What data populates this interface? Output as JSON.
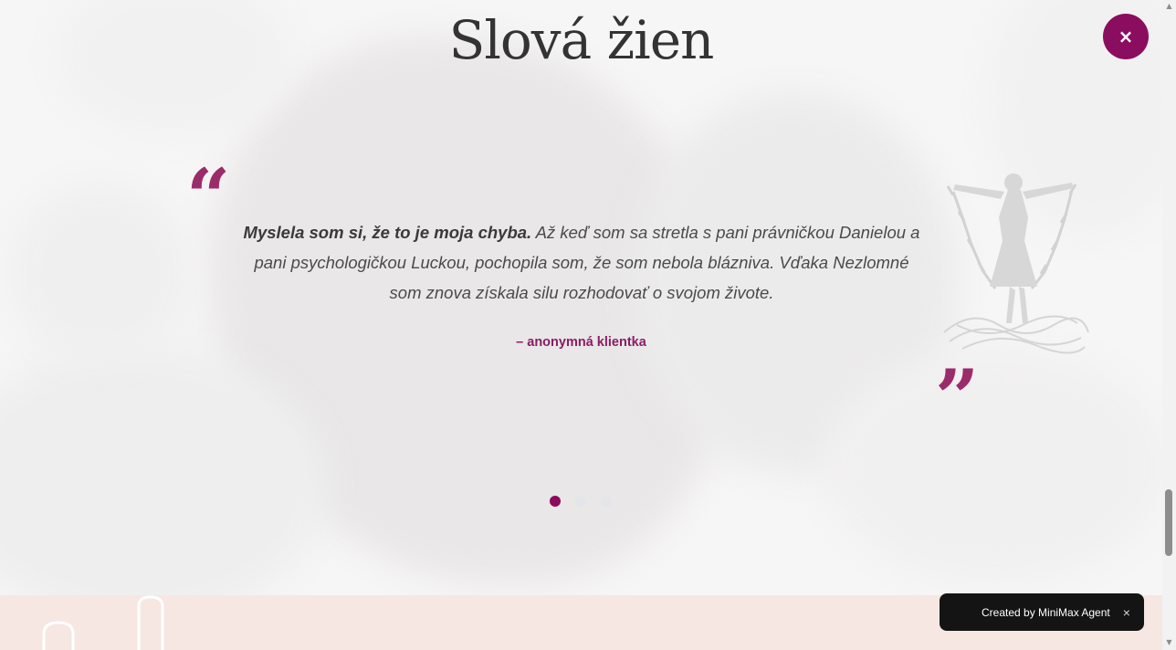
{
  "section": {
    "title": "Slová žien"
  },
  "testimonial": {
    "quote_bold": "Myslela som si, že to je moja chyba.",
    "quote_rest": " Až keď som sa stretla s pani právničkou Danielou a pani psychologičkou Luckou, pochopila som, že som nebola blázniva. Vďaka Nezlomné som znova získala silu rozhodovať o svojom živote.",
    "author": "– anonymná klientka",
    "open_mark": "“",
    "close_mark": "”"
  },
  "carousel": {
    "slides": 3,
    "active_index": 0
  },
  "close_button": {
    "label": "×"
  },
  "toast": {
    "label": "Created by MiniMax Agent",
    "close": "×"
  },
  "scrollbar": {
    "up": "▲",
    "down": "▼"
  },
  "colors": {
    "accent": "#8c0a5c",
    "quote_marks": "#9b2c6b",
    "band": "#f6e7e2"
  },
  "icons": {
    "illustration": "woman-breaking-chains-icon"
  }
}
